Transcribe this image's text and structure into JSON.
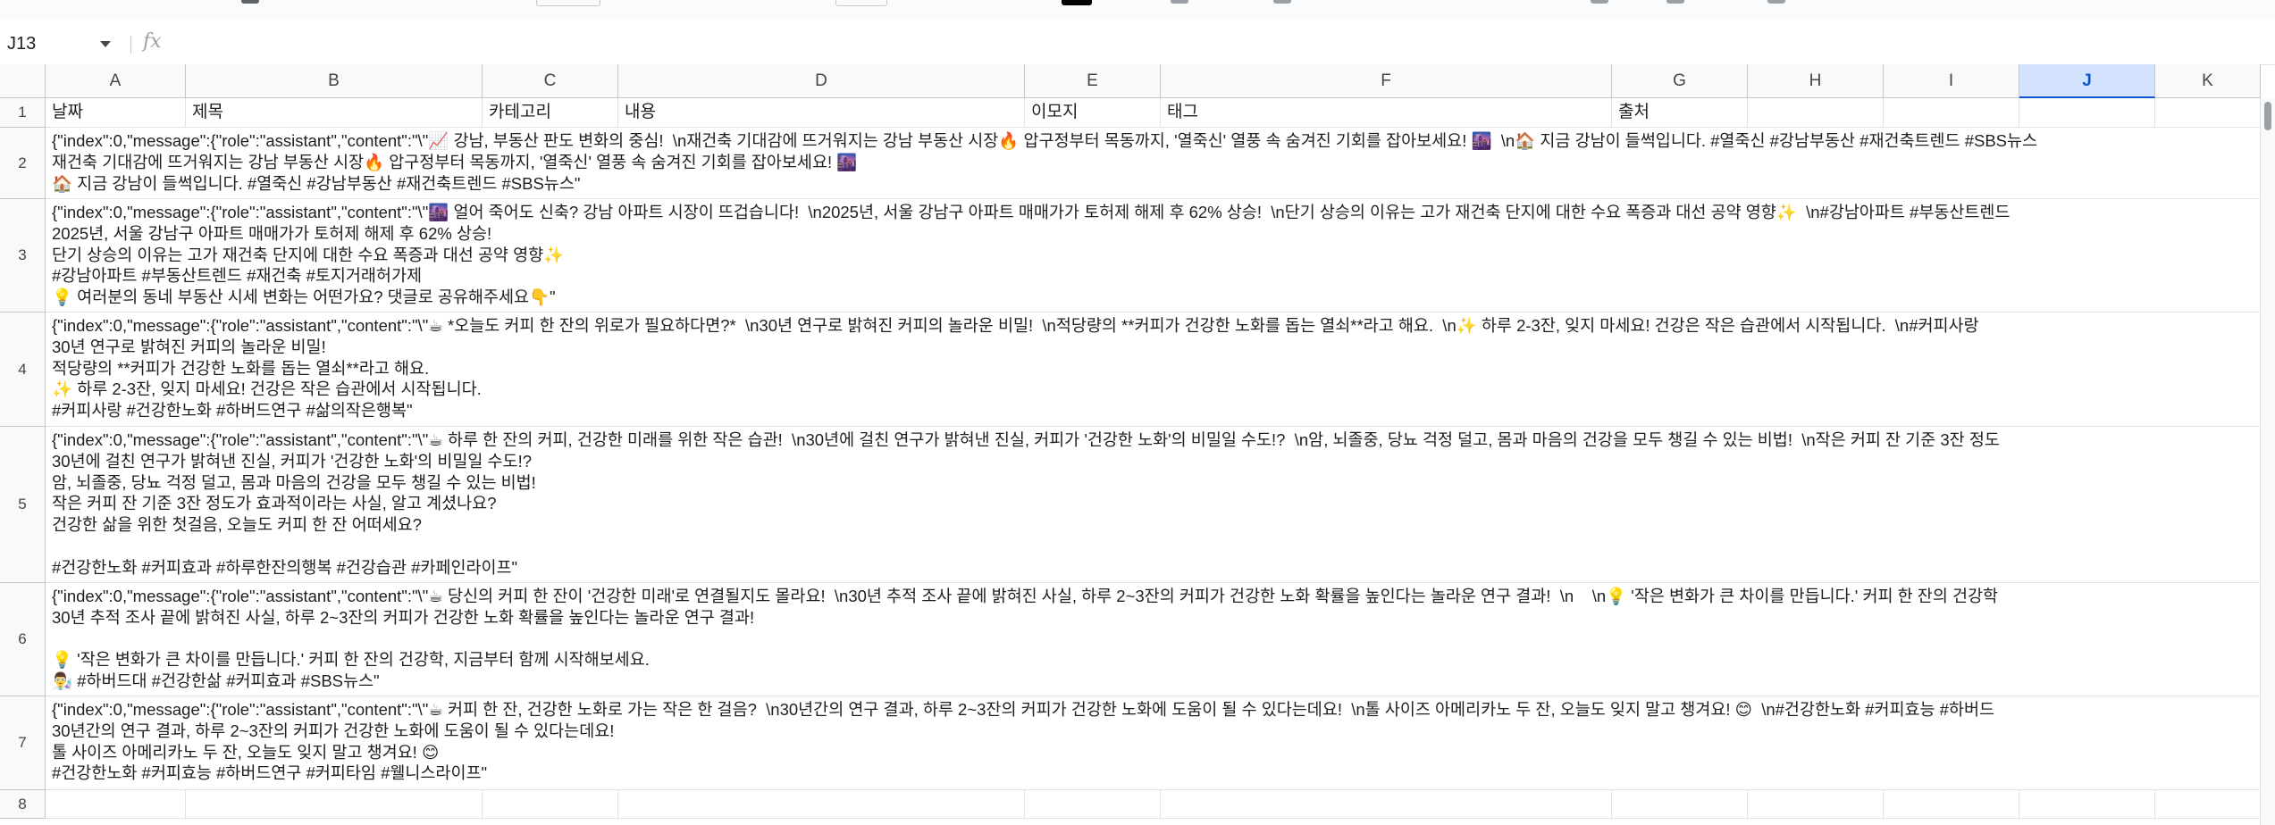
{
  "formula_bar": {
    "name_box": "J13",
    "fx_label": "fx"
  },
  "columns": [
    "A",
    "B",
    "C",
    "D",
    "E",
    "F",
    "G",
    "H",
    "I",
    "J",
    "K"
  ],
  "selected_column": "J",
  "headers": {
    "date": "날짜",
    "title": "제목",
    "category": "카테고리",
    "content": "내용",
    "emoji": "이모지",
    "tags": "태그",
    "source": "출처"
  },
  "rows": [
    {
      "num": "1"
    },
    {
      "num": "2",
      "text": "{\"index\":0,\"message\":{\"role\":\"assistant\",\"content\":\"\\\"📈 강남, 부동산 판도 변화의 중심!  \\n재건축 기대감에 뜨거워지는 강남 부동산 시장🔥 압구정부터 목동까지, '열죽신' 열풍 속 숨겨진 기회를 잡아보세요! 🌆  \\n🏠 지금 강남이 들썩입니다. #열죽신 #강남부동산 #재건축트렌드 #SBS뉴스\n재건축 기대감에 뜨거워지는 강남 부동산 시장🔥 압구정부터 목동까지, '열죽신' 열풍 속 숨겨진 기회를 잡아보세요! 🌆\n🏠 지금 강남이 들썩입니다. #열죽신 #강남부동산 #재건축트렌드 #SBS뉴스\""
    },
    {
      "num": "3",
      "text": "{\"index\":0,\"message\":{\"role\":\"assistant\",\"content\":\"\\\"🌆 얼어 죽어도 신축? 강남 아파트 시장이 뜨겁습니다!  \\n2025년, 서울 강남구 아파트 매매가가 토허제 해제 후 62% 상승!  \\n단기 상승의 이유는 고가 재건축 단지에 대한 수요 폭증과 대선 공약 영향✨  \\n#강남아파트 #부동산트렌드\n2025년, 서울 강남구 아파트 매매가가 토허제 해제 후 62% 상승!\n단기 상승의 이유는 고가 재건축 단지에 대한 수요 폭증과 대선 공약 영향✨\n#강남아파트 #부동산트렌드 #재건축 #토지거래허가제\n💡 여러분의 동네 부동산 시세 변화는 어떤가요? 댓글로 공유해주세요👇\""
    },
    {
      "num": "4",
      "text": "{\"index\":0,\"message\":{\"role\":\"assistant\",\"content\":\"\\\"☕ *오늘도 커피 한 잔의 위로가 필요하다면?*  \\n30년 연구로 밝혀진 커피의 놀라운 비밀!  \\n적당량의 **커피가 건강한 노화를 돕는 열쇠**라고 해요.  \\n✨ 하루 2-3잔, 잊지 마세요! 건강은 작은 습관에서 시작됩니다.  \\n#커피사랑\n30년 연구로 밝혀진 커피의 놀라운 비밀!\n적당량의 **커피가 건강한 노화를 돕는 열쇠**라고 해요.\n✨ 하루 2-3잔, 잊지 마세요! 건강은 작은 습관에서 시작됩니다.\n#커피사랑 #건강한노화 #하버드연구 #삶의작은행복\""
    },
    {
      "num": "5",
      "text": "{\"index\":0,\"message\":{\"role\":\"assistant\",\"content\":\"\\\"☕ 하루 한 잔의 커피, 건강한 미래를 위한 작은 습관!  \\n30년에 걸친 연구가 밝혀낸 진실, 커피가 '건강한 노화'의 비밀일 수도!?  \\n암, 뇌졸중, 당뇨 걱정 덜고, 몸과 마음의 건강을 모두 챙길 수 있는 비법!  \\n작은 커피 잔 기준 3잔 정도\n30년에 걸친 연구가 밝혀낸 진실, 커피가 '건강한 노화'의 비밀일 수도!?\n암, 뇌졸중, 당뇨 걱정 덜고, 몸과 마음의 건강을 모두 챙길 수 있는 비법!\n작은 커피 잔 기준 3잔 정도가 효과적이라는 사실, 알고 계셨나요?\n건강한 삶을 위한 첫걸음, 오늘도 커피 한 잔 어떠세요?\n\n#건강한노화 #커피효과 #하루한잔의행복 #건강습관 #카페인라이프\""
    },
    {
      "num": "6",
      "text": "{\"index\":0,\"message\":{\"role\":\"assistant\",\"content\":\"\\\"☕ 당신의 커피 한 잔이 '건강한 미래'로 연결될지도 몰라요!  \\n30년 추적 조사 끝에 밝혀진 사실, 하루 2~3잔의 커피가 건강한 노화 확률을 높인다는 놀라운 연구 결과!  \\n    \\n💡 '작은 변화가 큰 차이를 만듭니다.' 커피 한 잔의 건강학\n30년 추적 조사 끝에 밝혀진 사실, 하루 2~3잔의 커피가 건강한 노화 확률을 높인다는 놀라운 연구 결과!\n\n💡 '작은 변화가 큰 차이를 만듭니다.' 커피 한 잔의 건강학, 지금부터 함께 시작해보세요.\n👨‍🔬 #하버드대 #건강한삶 #커피효과 #SBS뉴스\""
    },
    {
      "num": "7",
      "text": "{\"index\":0,\"message\":{\"role\":\"assistant\",\"content\":\"\\\"☕ 커피 한 잔, 건강한 노화로 가는 작은 한 걸음?  \\n30년간의 연구 결과, 하루 2~3잔의 커피가 건강한 노화에 도움이 될 수 있다는데요!  \\n톨 사이즈 아메리카노 두 잔, 오늘도 잊지 말고 챙겨요! 😊  \\n#건강한노화 #커피효능 #하버드\n30년간의 연구 결과, 하루 2~3잔의 커피가 건강한 노화에 도움이 될 수 있다는데요!\n톨 사이즈 아메리카노 두 잔, 오늘도 잊지 말고 챙겨요! 😊\n#건강한노화 #커피효능 #하버드연구 #커피타임 #웰니스라이프\""
    },
    {
      "num": "8"
    }
  ]
}
